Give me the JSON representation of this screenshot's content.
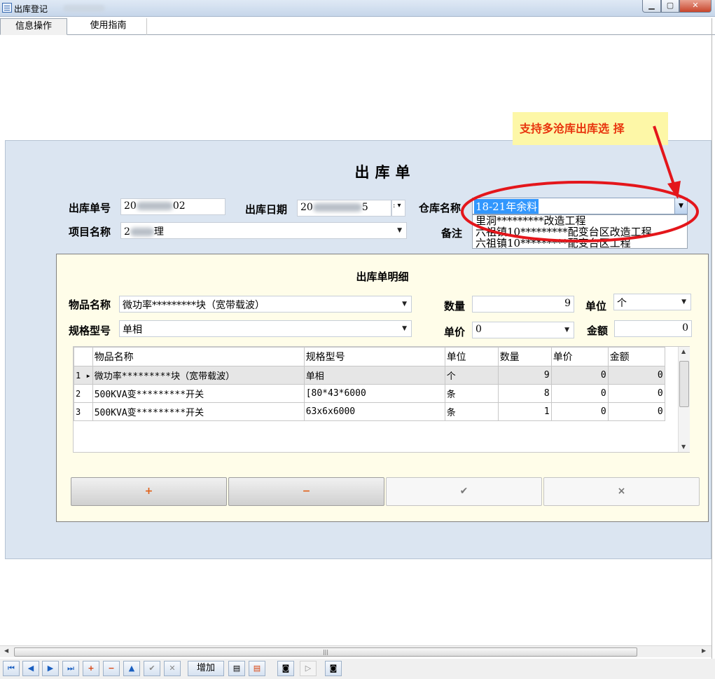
{
  "window": {
    "title": "出库登记"
  },
  "tabs": [
    {
      "label": "信息操作"
    },
    {
      "label": "使用指南"
    }
  ],
  "callout": {
    "text": "支持多沧库出库选 择"
  },
  "form": {
    "title": "出库单",
    "order_no_label": "出库单号",
    "order_no_prefix": "20",
    "order_no_suffix": "02",
    "date_label": "出库日期",
    "date_prefix": "20",
    "date_suffix": "5",
    "warehouse_label": "仓库名称",
    "warehouse_selected": "18-21年余料",
    "warehouse_options": [
      "里洞*********改造工程",
      "六祖镇10*********配变台区改造工程",
      "六祖镇10*********配变台区工程"
    ],
    "project_label": "项目名称",
    "project_prefix": "2",
    "project_suffix": "理",
    "remark_label": "备注"
  },
  "detail": {
    "title": "出库单明细",
    "item_name_label": "物品名称",
    "item_name_value": "微功率*********块（宽带载波）",
    "spec_label": "规格型号",
    "spec_value": "单相",
    "qty_label": "数量",
    "qty_value": "9",
    "unit_label": "单位",
    "unit_value": "个",
    "price_label": "单价",
    "price_value": "0",
    "amount_label": "金额",
    "amount_value": "0"
  },
  "grid": {
    "columns": [
      "物品名称",
      "规格型号",
      "单位",
      "数量",
      "单价",
      "金额"
    ],
    "rows": [
      {
        "idx": "1",
        "name": "微功率*********块（宽带载波）",
        "spec": "单相",
        "unit": "个",
        "qty": "9",
        "price": "0",
        "amount": "0"
      },
      {
        "idx": "2",
        "name": "500KVA变*********开关",
        "spec": "[80*43*6000",
        "unit": "条",
        "qty": "8",
        "price": "0",
        "amount": "0"
      },
      {
        "idx": "3",
        "name": "500KVA变*********开关",
        "spec": "63x6x6000",
        "unit": "条",
        "qty": "1",
        "price": "0",
        "amount": "0"
      }
    ]
  },
  "actions": {
    "add": "+",
    "remove": "−",
    "confirm": "✔",
    "cancel": "×"
  },
  "navigator": {
    "add_label": "增加"
  }
}
